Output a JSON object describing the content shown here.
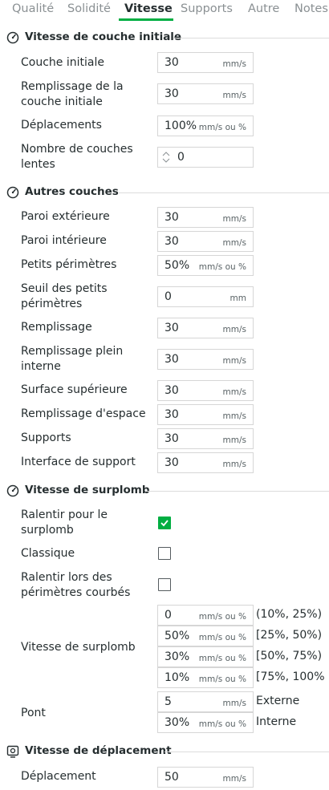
{
  "tabs": [
    {
      "label": "Qualité",
      "active": false
    },
    {
      "label": "Solidité",
      "active": false
    },
    {
      "label": "Vitesse",
      "active": true
    },
    {
      "label": "Supports",
      "active": false
    },
    {
      "label": "Autre",
      "active": false
    },
    {
      "label": "Notes",
      "active": false
    }
  ],
  "accent_color": "#00ae42",
  "sections": {
    "first_layer": {
      "title": "Vitesse de couche initiale",
      "icon": "speedometer-icon",
      "rows": [
        {
          "label": "Couche initiale",
          "value": "30",
          "unit": "mm/s"
        },
        {
          "label": "Remplissage de la couche initiale",
          "value": "30",
          "unit": "mm/s"
        },
        {
          "label": "Déplacements",
          "value": "100%",
          "unit": "mm/s ou %"
        },
        {
          "label": "Nombre de couches lentes",
          "value": "0",
          "unit": ""
        }
      ]
    },
    "other_layers": {
      "title": "Autres couches",
      "icon": "speedometer-icon",
      "rows": [
        {
          "label": "Paroi extérieure",
          "value": "30",
          "unit": "mm/s"
        },
        {
          "label": "Paroi intérieure",
          "value": "30",
          "unit": "mm/s"
        },
        {
          "label": "Petits périmètres",
          "value": "50%",
          "unit": "mm/s ou %"
        },
        {
          "label": "Seuil des petits périmètres",
          "value": "0",
          "unit": "mm"
        },
        {
          "label": "Remplissage",
          "value": "30",
          "unit": "mm/s"
        },
        {
          "label": "Remplissage plein interne",
          "value": "30",
          "unit": "mm/s"
        },
        {
          "label": "Surface supérieure",
          "value": "30",
          "unit": "mm/s"
        },
        {
          "label": "Remplissage d'espace",
          "value": "30",
          "unit": "mm/s"
        },
        {
          "label": "Supports",
          "value": "30",
          "unit": "mm/s"
        },
        {
          "label": "Interface de support",
          "value": "30",
          "unit": "mm/s"
        }
      ]
    },
    "overhang": {
      "title": "Vitesse de surplomb",
      "icon": "speedometer-icon",
      "checkboxes": [
        {
          "label": "Ralentir pour le surplomb",
          "checked": true
        },
        {
          "label": "Classique",
          "checked": false
        },
        {
          "label": "Ralentir lors des périmètres courbés",
          "checked": false
        }
      ],
      "overhang_speed": {
        "label": "Vitesse de surplomb",
        "rows": [
          {
            "value": "0",
            "unit": "mm/s ou %",
            "range": "(10%, 25%)"
          },
          {
            "value": "50%",
            "unit": "mm/s ou %",
            "range": "[25%, 50%)"
          },
          {
            "value": "30%",
            "unit": "mm/s ou %",
            "range": "[50%, 75%)"
          },
          {
            "value": "10%",
            "unit": "mm/s ou %",
            "range": "[75%, 100%"
          }
        ]
      },
      "bridge": {
        "label": "Pont",
        "rows": [
          {
            "value": "5",
            "unit": "mm/s",
            "suffix": "Externe"
          },
          {
            "value": "30%",
            "unit": "mm/s ou %",
            "suffix": "Interne"
          }
        ]
      }
    },
    "travel": {
      "title": "Vitesse de déplacement",
      "icon": "travel-speed-icon",
      "rows": [
        {
          "label": "Déplacement",
          "value": "50",
          "unit": "mm/s"
        }
      ]
    }
  }
}
